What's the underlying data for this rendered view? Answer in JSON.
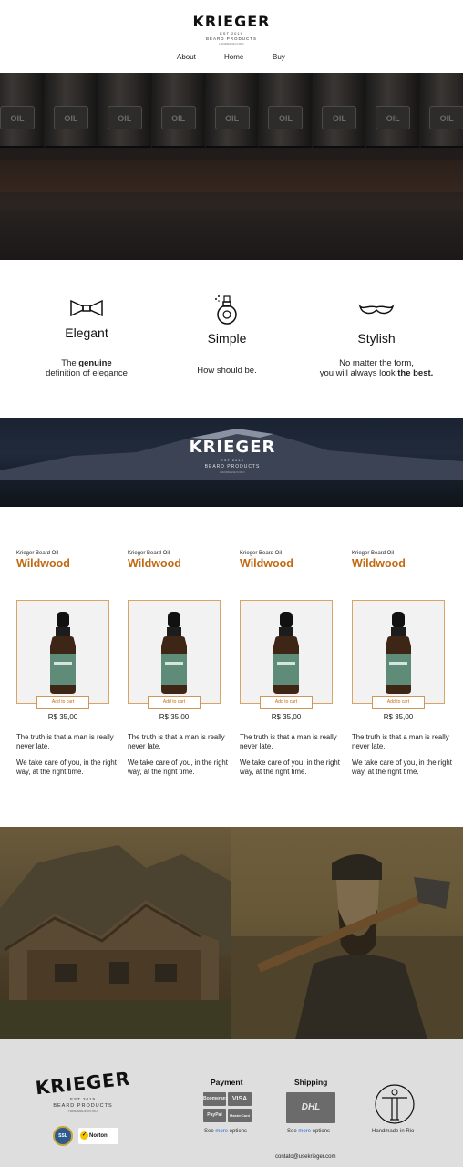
{
  "header": {
    "logo": {
      "word": "KRIEGER",
      "est": "EST 2019",
      "sub": "BEARD PRODUCTS",
      "sub2": "HANDMADE IN RIO"
    },
    "nav": [
      {
        "label": "About"
      },
      {
        "label": "Home"
      },
      {
        "label": "Buy"
      }
    ]
  },
  "hero": {
    "label_text": "OIL"
  },
  "features": [
    {
      "icon": "bowtie-icon",
      "title": "Elegant",
      "desc_pre": "The ",
      "desc_bold": "genuine",
      "desc_line2": "definition of elegance"
    },
    {
      "icon": "perfume-icon",
      "title": "Simple",
      "desc": "How should be."
    },
    {
      "icon": "mustache-icon",
      "title": "Stylish",
      "desc_line1": "No matter the form,",
      "desc_pre": "you will always look ",
      "desc_bold": "the best."
    }
  ],
  "banner": {
    "word": "KRIEGER",
    "est": "EST 2019",
    "sub": "BEARD PRODUCTS",
    "sub2": "HANDMADE IN RIO"
  },
  "products": [
    {
      "subtitle": "Krieger Beard Oil",
      "name": "Wildwood",
      "button": "Add to cart",
      "price": "R$ 35,00",
      "desc1": "The truth is that a man is really never late.",
      "desc2": "We take care of you, in the right way, at the right time."
    },
    {
      "subtitle": "Krieger Beard Oil",
      "name": "Wildwood",
      "button": "Add to cart",
      "price": "R$ 35,00",
      "desc1": "The truth is that a man is really never late.",
      "desc2": "We take care of you, in the right way, at the right time."
    },
    {
      "subtitle": "Krieger Beard Oil",
      "name": "Wildwood",
      "button": "Add to cart",
      "price": "R$ 35,00",
      "desc1": "The truth is that a man is really never late.",
      "desc2": "We take care of you, in the right way, at the right time."
    },
    {
      "subtitle": "Krieger Beard Oil",
      "name": "Wildwood",
      "button": "Add to cart",
      "price": "R$ 35,00",
      "desc1": "The truth is that a man is really never late.",
      "desc2": "We take care of you, in the right way, at the right time."
    }
  ],
  "footer": {
    "logo": {
      "word": "KRIEGER",
      "est": "EST 2019",
      "sub": "BEARD PRODUCTS",
      "sub2": "HANDMADE IN RIO"
    },
    "badges": [
      "SSL",
      "Norton"
    ],
    "payment": {
      "title": "Payment",
      "cards": [
        "Boomerang",
        "VISA",
        "PayPal",
        "MasterCard"
      ],
      "note_pre": "See ",
      "note_more": "more",
      "note_post": " options"
    },
    "shipping": {
      "title": "Shipping",
      "carrier": "DHL",
      "note_pre": "See ",
      "note_more": "more",
      "note_post": " options"
    },
    "made": {
      "label": "Handmade in Rio"
    },
    "email": "contato@usekrieger.com"
  },
  "colors": {
    "accent": "#c06a14",
    "border": "#d9a46a",
    "footer_bg": "#dedede"
  }
}
